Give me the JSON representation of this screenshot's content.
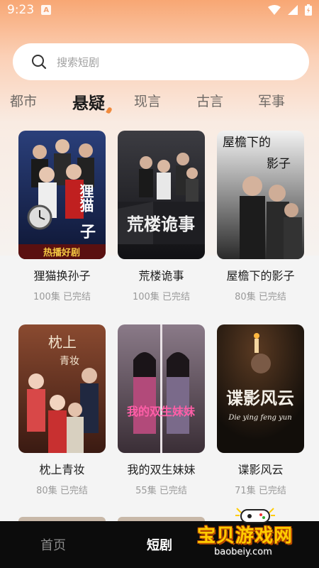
{
  "status_bar": {
    "time": "9:23",
    "app_icon_letter": "A"
  },
  "search": {
    "placeholder": "搜索短剧"
  },
  "tabs": [
    {
      "label": "都市",
      "active": false
    },
    {
      "label": "悬疑",
      "active": true
    },
    {
      "label": "现言",
      "active": false
    },
    {
      "label": "古言",
      "active": false
    },
    {
      "label": "军事",
      "active": false
    }
  ],
  "dramas": [
    {
      "title": "狸猫换孙子",
      "meta": "100集 已完结",
      "cover_text": "狸猫换孙子",
      "cover_badge": "热播好剧",
      "cover_color": "#1b2a55"
    },
    {
      "title": "荒楼诡事",
      "meta": "100集 已完结",
      "cover_text": "荒楼诡事",
      "cover_color": "#2a2a2e"
    },
    {
      "title": "屋檐下的影子",
      "meta": "80集 已完结",
      "cover_text": "屋檐下的影子",
      "cover_color": "#3b3b3b"
    },
    {
      "title": "枕上青妆",
      "meta": "80集 已完结",
      "cover_text": "枕上青妆",
      "cover_color": "#7a3a2a"
    },
    {
      "title": "我的双生妹妹",
      "meta": "55集 已完结",
      "cover_text": "我的双生妹妹",
      "cover_color": "#6a5560"
    },
    {
      "title": "谍影风云",
      "meta": "71集 已完结",
      "cover_text": "谍影风云",
      "cover_subtext": "Die ying feng yun",
      "cover_color": "#1a1410"
    }
  ],
  "bottom_nav": [
    {
      "label": "首页",
      "active": false
    },
    {
      "label": "短剧",
      "active": true
    },
    {
      "label": "",
      "active": false
    }
  ],
  "watermark": {
    "title": "宝贝游戏网",
    "url": "baobeiy.com"
  },
  "colors": {
    "accent": "#f08a3c",
    "nav_bg": "#0c0c0c",
    "header_gradient_top": "#f8a774"
  }
}
